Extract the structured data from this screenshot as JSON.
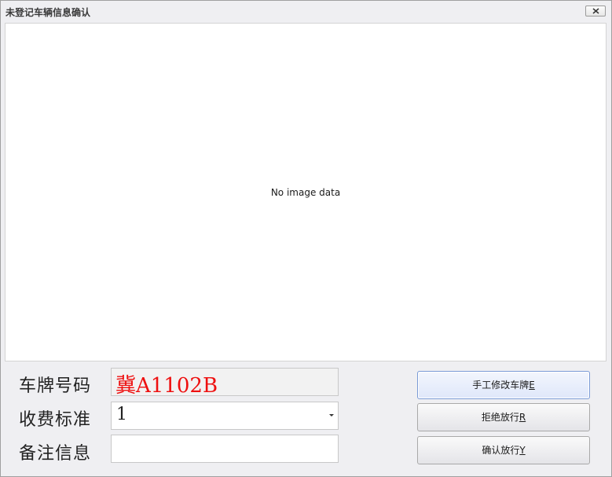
{
  "window": {
    "title": "未登记车辆信息确认",
    "close_icon": "close-icon"
  },
  "image_panel": {
    "placeholder": "No image data"
  },
  "form": {
    "plate_label": "车牌号码",
    "plate_value": "冀A1102B",
    "plate_color": "#ee1010",
    "fee_label": "收费标准",
    "fee_value": "1",
    "remark_label": "备注信息",
    "remark_value": ""
  },
  "buttons": {
    "edit_plate": {
      "label": "手工修改车牌",
      "shortcut": "E"
    },
    "reject": {
      "label": "拒绝放行",
      "shortcut": "R"
    },
    "confirm": {
      "label": "确认放行",
      "shortcut": "Y"
    }
  }
}
